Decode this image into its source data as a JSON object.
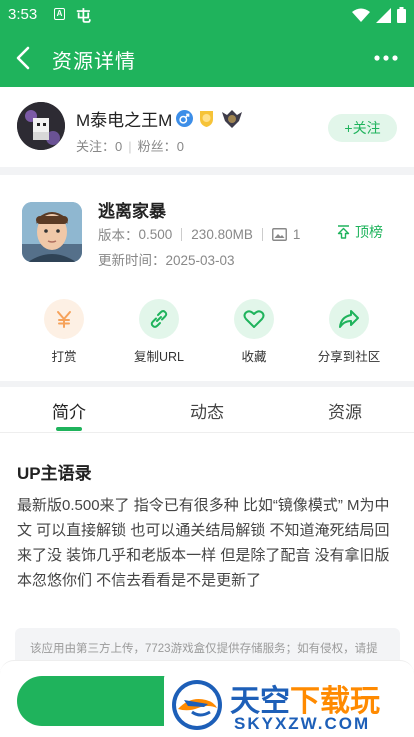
{
  "status_bar": {
    "time": "3:53",
    "icon_a": "A",
    "icon_b": "屯"
  },
  "appbar": {
    "title": "资源详情"
  },
  "user": {
    "name": "M泰电之王M",
    "follow_label": "关注",
    "following_count": "0",
    "fans_label": "粉丝",
    "fans_count": "0",
    "follow_button": "+关注"
  },
  "game": {
    "name": "逃离家暴",
    "version_label": "版本",
    "version": "0.500",
    "size": "230.80MB",
    "image_count": "1",
    "update_label": "更新时间",
    "update_date": "2025-03-03",
    "pin_button": "顶榜"
  },
  "actions": [
    {
      "label": "打赏",
      "icon": "yen-icon",
      "color": "#f6a25a",
      "bg": "#fdf0e4"
    },
    {
      "label": "复制URL",
      "icon": "link-icon",
      "color": "#1fb35c",
      "bg": "#e2f6ea"
    },
    {
      "label": "收藏",
      "icon": "heart-icon",
      "color": "#1fb35c",
      "bg": "#e2f6ea"
    },
    {
      "label": "分享到社区",
      "icon": "share-icon",
      "color": "#1fb35c",
      "bg": "#e2f6ea"
    }
  ],
  "tabs": [
    "简介",
    "动态",
    "资源"
  ],
  "intro": {
    "title": "UP主语录",
    "body": "最新版0.500来了 指令已有很多种 比如“镜像模式” M为中文 可以直接解锁 也可以通关结局解锁 不知道淹死结局回来了没 装饰几乎和老版本一样 但是除了配音 没有拿旧版本忽悠你们 不信去看看是不是更新了",
    "notice": "该应用由第三方上传，7723游戏盒仅提供存储服务；如有侵权，请提"
  },
  "watermark": {
    "cn_blue": "天空",
    "cn_orange": "下载玩",
    "en": "SKYXZW.COM"
  },
  "colors": {
    "brand": "#1fb35c",
    "tint": "#e2f6ea"
  }
}
